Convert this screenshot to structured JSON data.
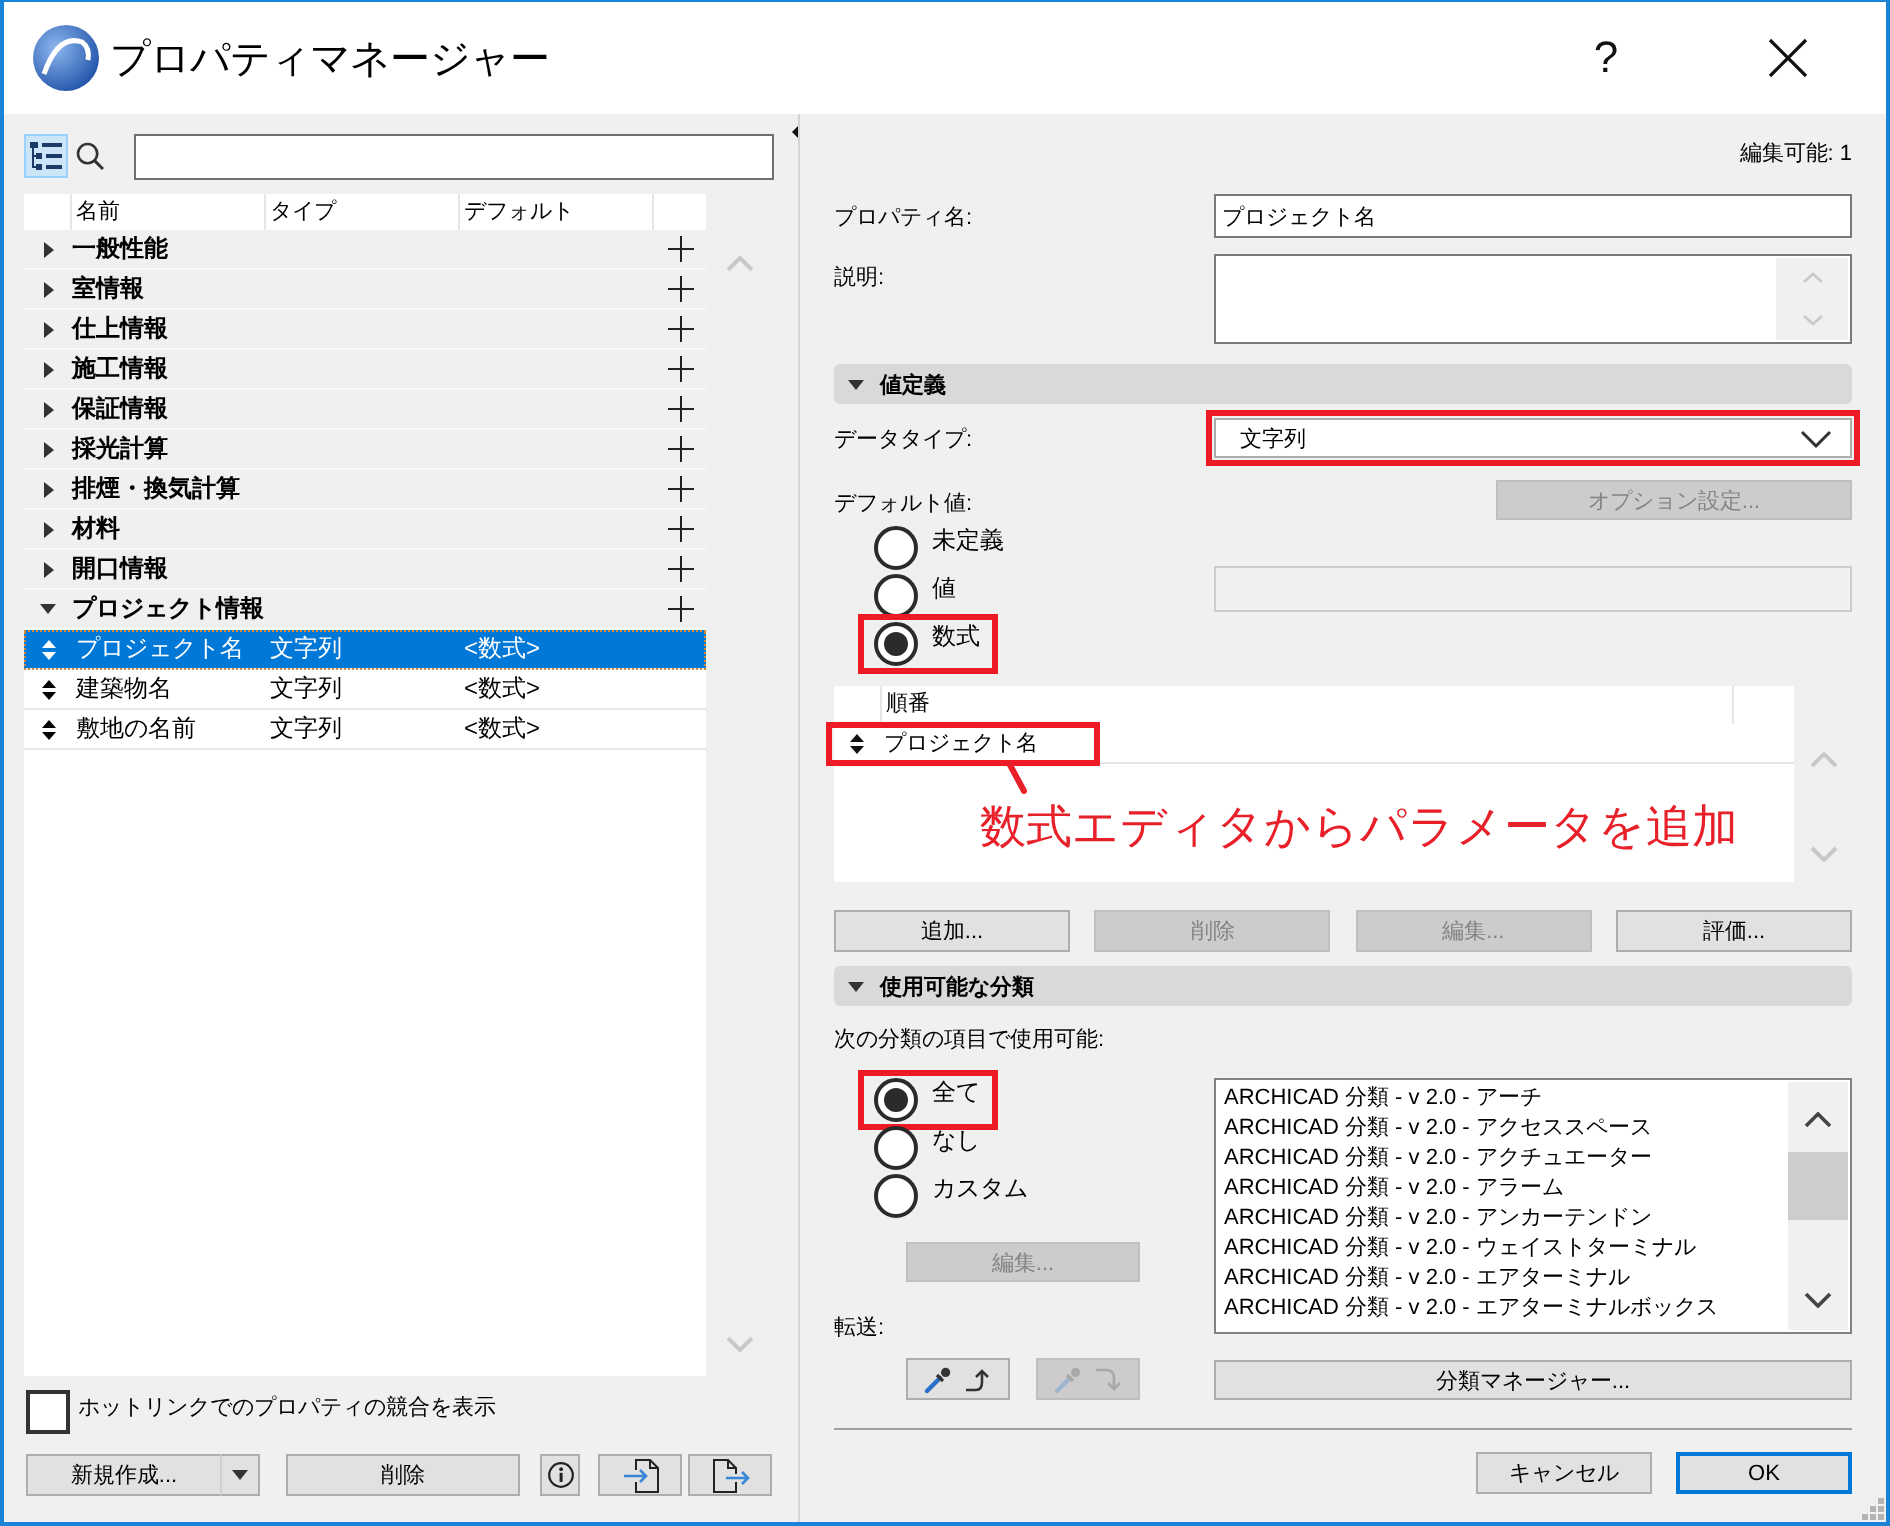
{
  "window": {
    "title": "プロパティマネージャー",
    "help": "?"
  },
  "tree": {
    "columns": [
      "名前",
      "タイプ",
      "デフォルト"
    ],
    "items": [
      {
        "name": "一般性能",
        "expanded": false
      },
      {
        "name": "室情報",
        "expanded": false
      },
      {
        "name": "仕上情報",
        "expanded": false
      },
      {
        "name": "施工情報",
        "expanded": false
      },
      {
        "name": "保証情報",
        "expanded": false
      },
      {
        "name": "採光計算",
        "expanded": false
      },
      {
        "name": "排煙・換気計算",
        "expanded": false
      },
      {
        "name": "材料",
        "expanded": false
      },
      {
        "name": "開口情報",
        "expanded": false
      },
      {
        "name": "プロジェクト情報",
        "expanded": true,
        "children": [
          {
            "name": "プロジェクト名",
            "type": "文字列",
            "default": "<数式>",
            "selected": true
          },
          {
            "name": "建築物名",
            "type": "文字列",
            "default": "<数式>",
            "selected": false
          },
          {
            "name": "敷地の名前",
            "type": "文字列",
            "default": "<数式>",
            "selected": false
          }
        ]
      }
    ]
  },
  "hotlink_conflicts": {
    "label": "ホットリンクでのプロパティの競合を表示",
    "checked": false
  },
  "left_buttons": {
    "new": "新規作成...",
    "delete": "削除"
  },
  "editable_count": "編集可能: 1",
  "property_name": {
    "label": "プロパティ名:",
    "value": "プロジェクト名"
  },
  "description": {
    "label": "説明:"
  },
  "value_definition": {
    "title": "値定義",
    "expanded": true,
    "data_type": {
      "label": "データタイプ:",
      "value": "文字列",
      "highlighted": true
    },
    "default_value": {
      "label": "デフォルト値:",
      "options_button": {
        "label": "オプション設定...",
        "disabled": true
      },
      "options": [
        {
          "label": "未定義",
          "selected": false,
          "kind": "plain"
        },
        {
          "label": "値",
          "selected": false,
          "kind": "plain",
          "field": {
            "disabled": true
          }
        },
        {
          "label": "数式",
          "selected": true,
          "kind": "framed"
        }
      ]
    },
    "order_list": {
      "column": "順番",
      "rows": [
        {
          "name": "プロジェクト名",
          "highlighted": true
        }
      ],
      "annotation": "数式エディタからパラメータを追加"
    },
    "buttons": [
      {
        "label": "追加...",
        "disabled": false
      },
      {
        "label": "削除",
        "disabled": true
      },
      {
        "label": "編集...",
        "disabled": true
      },
      {
        "label": "評価...",
        "disabled": false
      }
    ]
  },
  "classification": {
    "title": "使用可能な分類",
    "expanded": true,
    "label": "次の分類の項目で使用可能:",
    "options": [
      {
        "label": "全て",
        "selected": true,
        "kind": "framed"
      },
      {
        "label": "なし",
        "selected": false,
        "kind": "plain"
      },
      {
        "label": "カスタム",
        "selected": false,
        "kind": "plain"
      }
    ],
    "edit_button": {
      "label": "編集...",
      "disabled": true
    },
    "transfer": {
      "label": "転送:",
      "buttons": [
        {
          "disabled": false
        },
        {
          "disabled": true
        }
      ]
    },
    "items": [
      "ARCHICAD 分類 - v 2.0 - アーチ",
      "ARCHICAD 分類 - v 2.0 - アクセススペース",
      "ARCHICAD 分類 - v 2.0 - アクチュエーター",
      "ARCHICAD 分類 - v 2.0 - アラーム",
      "ARCHICAD 分類 - v 2.0 - アンカーテンドン",
      "ARCHICAD 分類 - v 2.0 - ウェイストターミナル",
      "ARCHICAD 分類 - v 2.0 - エアターミナル",
      "ARCHICAD 分類 - v 2.0 - エアターミナルボックス"
    ],
    "manager_button": "分類マネージャー..."
  },
  "dialog_buttons": [
    {
      "label": "キャンセル",
      "default": false
    },
    {
      "label": "OK",
      "default": true
    }
  ]
}
